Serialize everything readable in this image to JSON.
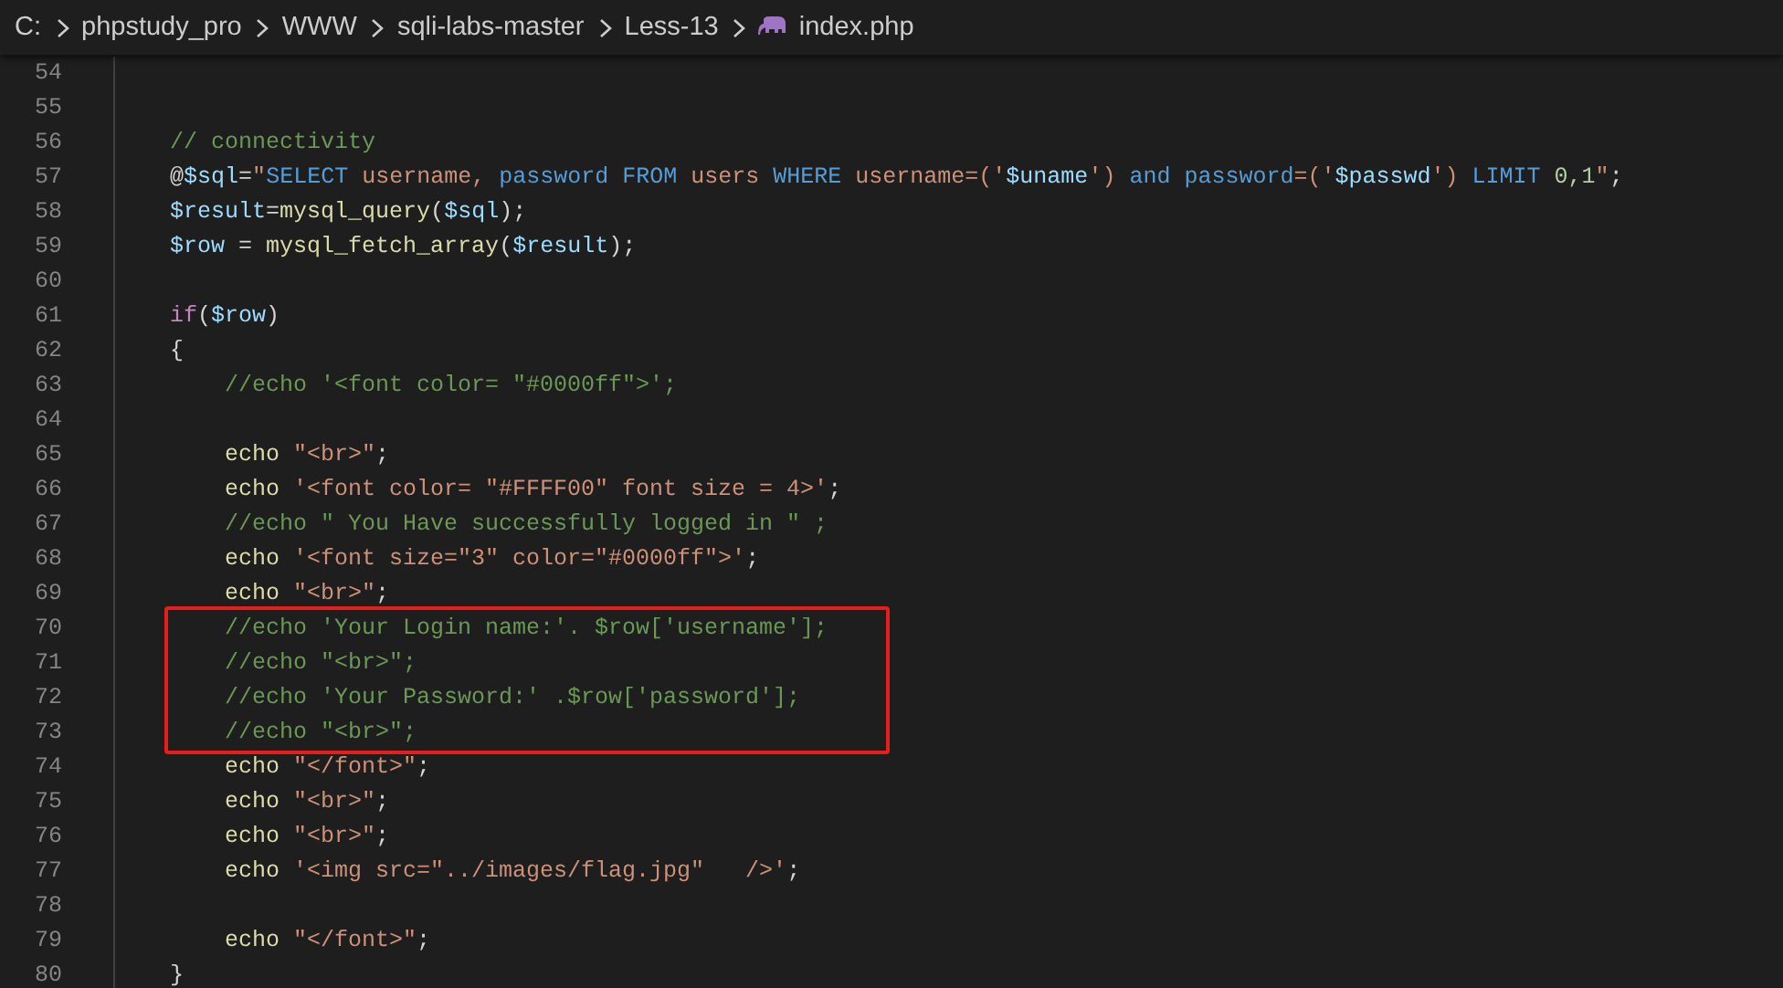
{
  "breadcrumb": {
    "folders": [
      "C:",
      "phpstudy_pro",
      "WWW",
      "sqli-labs-master",
      "Less-13"
    ],
    "file": "index.php"
  },
  "editor": {
    "blocks": [
      {
        "kind": "plain",
        "lines": [
          {
            "number": "54"
          },
          {
            "number": "55"
          },
          {
            "number": "56",
            "kind": "outer",
            "tokens": [
              {
                "t": "// connectivity",
                "kind": "comment"
              }
            ]
          },
          {
            "number": "57",
            "kind": "outer",
            "tokens": [
              {
                "t": "@",
                "kind": "plain"
              },
              {
                "t": "$sql",
                "kind": "variable"
              },
              {
                "t": "=",
                "kind": "plain"
              },
              {
                "t": "\"",
                "kind": "string"
              },
              {
                "t": "SELECT",
                "kind": "sql"
              },
              {
                "t": " username, ",
                "kind": "string"
              },
              {
                "t": "password FROM",
                "kind": "sql"
              },
              {
                "t": " users ",
                "kind": "string"
              },
              {
                "t": "WHERE",
                "kind": "sql"
              },
              {
                "t": " username=('",
                "kind": "string"
              },
              {
                "t": "$uname",
                "kind": "variable"
              },
              {
                "t": "') ",
                "kind": "string"
              },
              {
                "t": "and password",
                "kind": "sql"
              },
              {
                "t": "=('",
                "kind": "string"
              },
              {
                "t": "$passwd",
                "kind": "variable"
              },
              {
                "t": "') ",
                "kind": "string"
              },
              {
                "t": "LIMIT ",
                "kind": "sql"
              },
              {
                "t": "0,1",
                "kind": "number"
              },
              {
                "t": "\"",
                "kind": "string"
              },
              {
                "t": ";",
                "kind": "plain"
              }
            ]
          },
          {
            "number": "58",
            "kind": "outer",
            "tokens": [
              {
                "t": "$result",
                "kind": "variable"
              },
              {
                "t": "=",
                "kind": "plain"
              },
              {
                "t": "mysql_query",
                "kind": "function"
              },
              {
                "t": "(",
                "kind": "plain"
              },
              {
                "t": "$sql",
                "kind": "variable"
              },
              {
                "t": ");",
                "kind": "plain"
              }
            ]
          },
          {
            "number": "59",
            "kind": "outer",
            "tokens": [
              {
                "t": "$row",
                "kind": "variable"
              },
              {
                "t": " = ",
                "kind": "plain"
              },
              {
                "t": "mysql_fetch_array",
                "kind": "function"
              },
              {
                "t": "(",
                "kind": "plain"
              },
              {
                "t": "$result",
                "kind": "variable"
              },
              {
                "t": ");",
                "kind": "plain"
              }
            ]
          },
          {
            "number": "60"
          },
          {
            "number": "61",
            "kind": "outer",
            "tokens": [
              {
                "t": "if",
                "kind": "control"
              },
              {
                "t": "(",
                "kind": "plain"
              },
              {
                "t": "$row",
                "kind": "variable"
              },
              {
                "t": ")",
                "kind": "plain"
              }
            ]
          },
          {
            "number": "62",
            "kind": "outer",
            "tokens": [
              {
                "t": "{",
                "kind": "plain"
              }
            ]
          },
          {
            "number": "63",
            "kind": "inner",
            "tokens": [
              {
                "t": "//echo '<font color= \"#0000ff\">';",
                "kind": "comment"
              }
            ]
          },
          {
            "number": "64"
          },
          {
            "number": "65",
            "kind": "inner",
            "tokens": [
              {
                "t": "echo ",
                "kind": "function"
              },
              {
                "t": "\"<br>\"",
                "kind": "string"
              },
              {
                "t": ";",
                "kind": "plain"
              }
            ]
          },
          {
            "number": "66",
            "kind": "inner",
            "tokens": [
              {
                "t": "echo ",
                "kind": "function"
              },
              {
                "t": "'<font color= \"#FFFF00\" font size = 4>'",
                "kind": "string"
              },
              {
                "t": ";",
                "kind": "plain"
              }
            ]
          },
          {
            "number": "67",
            "kind": "inner",
            "tokens": [
              {
                "t": "//echo \" You Have successfully logged in \" ;",
                "kind": "comment"
              }
            ]
          },
          {
            "number": "68",
            "kind": "inner",
            "tokens": [
              {
                "t": "echo ",
                "kind": "function"
              },
              {
                "t": "'<font size=\"3\" color=\"#0000ff\">'",
                "kind": "string"
              },
              {
                "t": ";",
                "kind": "plain"
              }
            ]
          },
          {
            "number": "69",
            "kind": "inner",
            "tokens": [
              {
                "t": "echo ",
                "kind": "function"
              },
              {
                "t": "\"<br>\"",
                "kind": "string"
              },
              {
                "t": ";",
                "kind": "plain"
              }
            ]
          }
        ]
      },
      {
        "kind": "highlight",
        "lines": [
          {
            "number": "70",
            "kind": "inner",
            "tokens": [
              {
                "t": "//echo 'Your Login name:'. $row['username'];",
                "kind": "comment"
              }
            ]
          },
          {
            "number": "71",
            "kind": "inner",
            "tokens": [
              {
                "t": "//echo \"<br>\";",
                "kind": "comment"
              }
            ]
          },
          {
            "number": "72",
            "kind": "inner",
            "tokens": [
              {
                "t": "//echo 'Your Password:' .$row['password'];",
                "kind": "comment"
              }
            ]
          },
          {
            "number": "73",
            "kind": "inner",
            "tokens": [
              {
                "t": "//echo \"<br>\";",
                "kind": "comment"
              }
            ]
          }
        ]
      },
      {
        "kind": "plain",
        "lines": [
          {
            "number": "74",
            "kind": "inner",
            "tokens": [
              {
                "t": "echo ",
                "kind": "function"
              },
              {
                "t": "\"</font>\"",
                "kind": "string"
              },
              {
                "t": ";",
                "kind": "plain"
              }
            ]
          },
          {
            "number": "75",
            "kind": "inner",
            "tokens": [
              {
                "t": "echo ",
                "kind": "function"
              },
              {
                "t": "\"<br>\"",
                "kind": "string"
              },
              {
                "t": ";",
                "kind": "plain"
              }
            ]
          },
          {
            "number": "76",
            "kind": "inner",
            "tokens": [
              {
                "t": "echo ",
                "kind": "function"
              },
              {
                "t": "\"<br>\"",
                "kind": "string"
              },
              {
                "t": ";",
                "kind": "plain"
              }
            ]
          },
          {
            "number": "77",
            "kind": "inner",
            "tokens": [
              {
                "t": "echo ",
                "kind": "function"
              },
              {
                "t": "'<img src=\"../images/flag.jpg\"   />'",
                "kind": "string"
              },
              {
                "t": ";",
                "kind": "plain"
              }
            ]
          },
          {
            "number": "78"
          },
          {
            "number": "79",
            "kind": "inner",
            "tokens": [
              {
                "t": "echo ",
                "kind": "function"
              },
              {
                "t": "\"</font>\"",
                "kind": "string"
              },
              {
                "t": ";",
                "kind": "plain"
              }
            ]
          },
          {
            "number": "80",
            "kind": "outer",
            "tokens": [
              {
                "t": "}",
                "kind": "plain"
              }
            ]
          }
        ]
      }
    ]
  }
}
